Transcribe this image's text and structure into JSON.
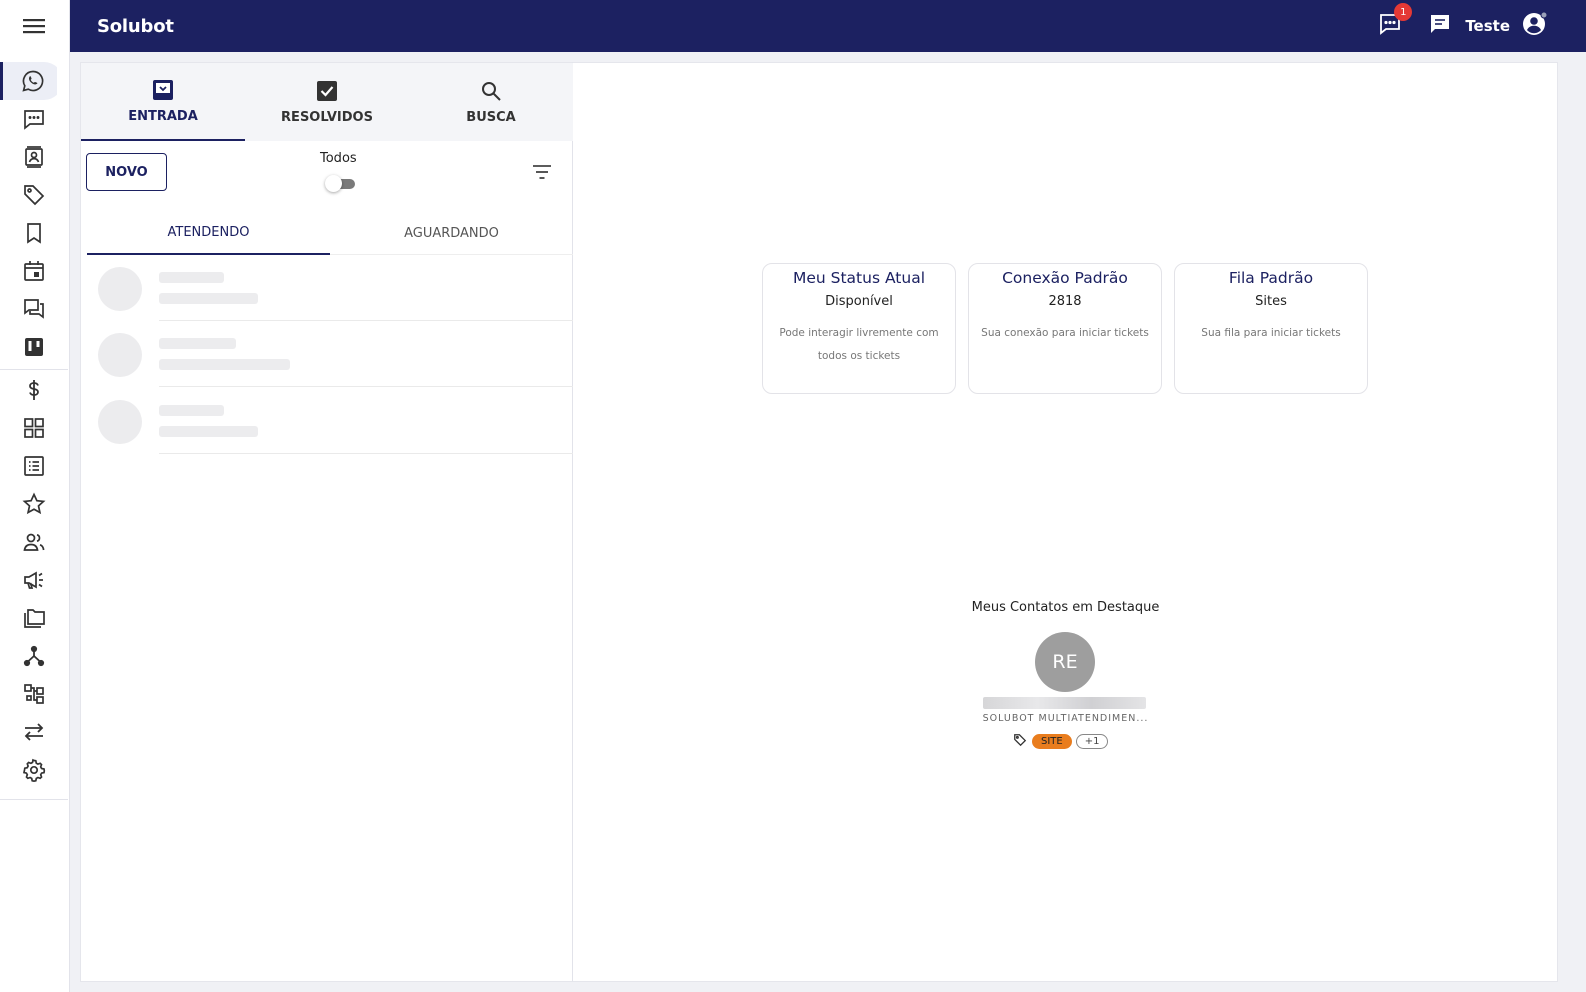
{
  "header": {
    "app_title": "Solubot",
    "notification_count": "1",
    "user_name": "Teste"
  },
  "sidebar": {
    "items": [
      {
        "name": "whatsapp-icon"
      },
      {
        "name": "chat-dots-icon"
      },
      {
        "name": "contacts-icon"
      },
      {
        "name": "tag-icon"
      },
      {
        "name": "bookmark-icon"
      },
      {
        "name": "calendar-icon"
      },
      {
        "name": "forum-icon"
      },
      {
        "name": "kanban-icon"
      },
      {
        "name": "dollar-icon"
      },
      {
        "name": "dashboard-grid-icon"
      },
      {
        "name": "list-icon"
      },
      {
        "name": "star-icon"
      },
      {
        "name": "users-icon"
      },
      {
        "name": "megaphone-icon"
      },
      {
        "name": "folders-icon"
      },
      {
        "name": "hierarchy-icon"
      },
      {
        "name": "workflow-icon"
      },
      {
        "name": "swap-icon"
      },
      {
        "name": "gear-icon"
      }
    ]
  },
  "tickets": {
    "tabs": [
      {
        "label": "ENTRADA",
        "icon": "inbox-icon"
      },
      {
        "label": "RESOLVIDOS",
        "icon": "check-square-icon"
      },
      {
        "label": "BUSCA",
        "icon": "search-icon"
      }
    ],
    "new_button": "NOVO",
    "toggle_label": "Todos",
    "subtabs": [
      "ATENDENDO",
      "AGUARDANDO"
    ]
  },
  "main": {
    "cards": [
      {
        "title": "Meu Status Atual",
        "value": "Disponível",
        "description": "Pode interagir livremente com todos os tickets"
      },
      {
        "title": "Conexão Padrão",
        "value": "2818",
        "description": "Sua conexão para iniciar tickets"
      },
      {
        "title": "Fila Padrão",
        "value": "Sites",
        "description": "Sua fila para iniciar tickets"
      }
    ],
    "featured_title": "Meus Contatos em Destaque",
    "contact": {
      "initials": "RE",
      "company": "SOLUBOT MULTIATENDIMEN...",
      "tag": "SITE",
      "more_tags": "+1"
    }
  },
  "colors": {
    "primary": "#1c2161",
    "tag_site": "#e97d1e",
    "badge": "#e53935"
  }
}
